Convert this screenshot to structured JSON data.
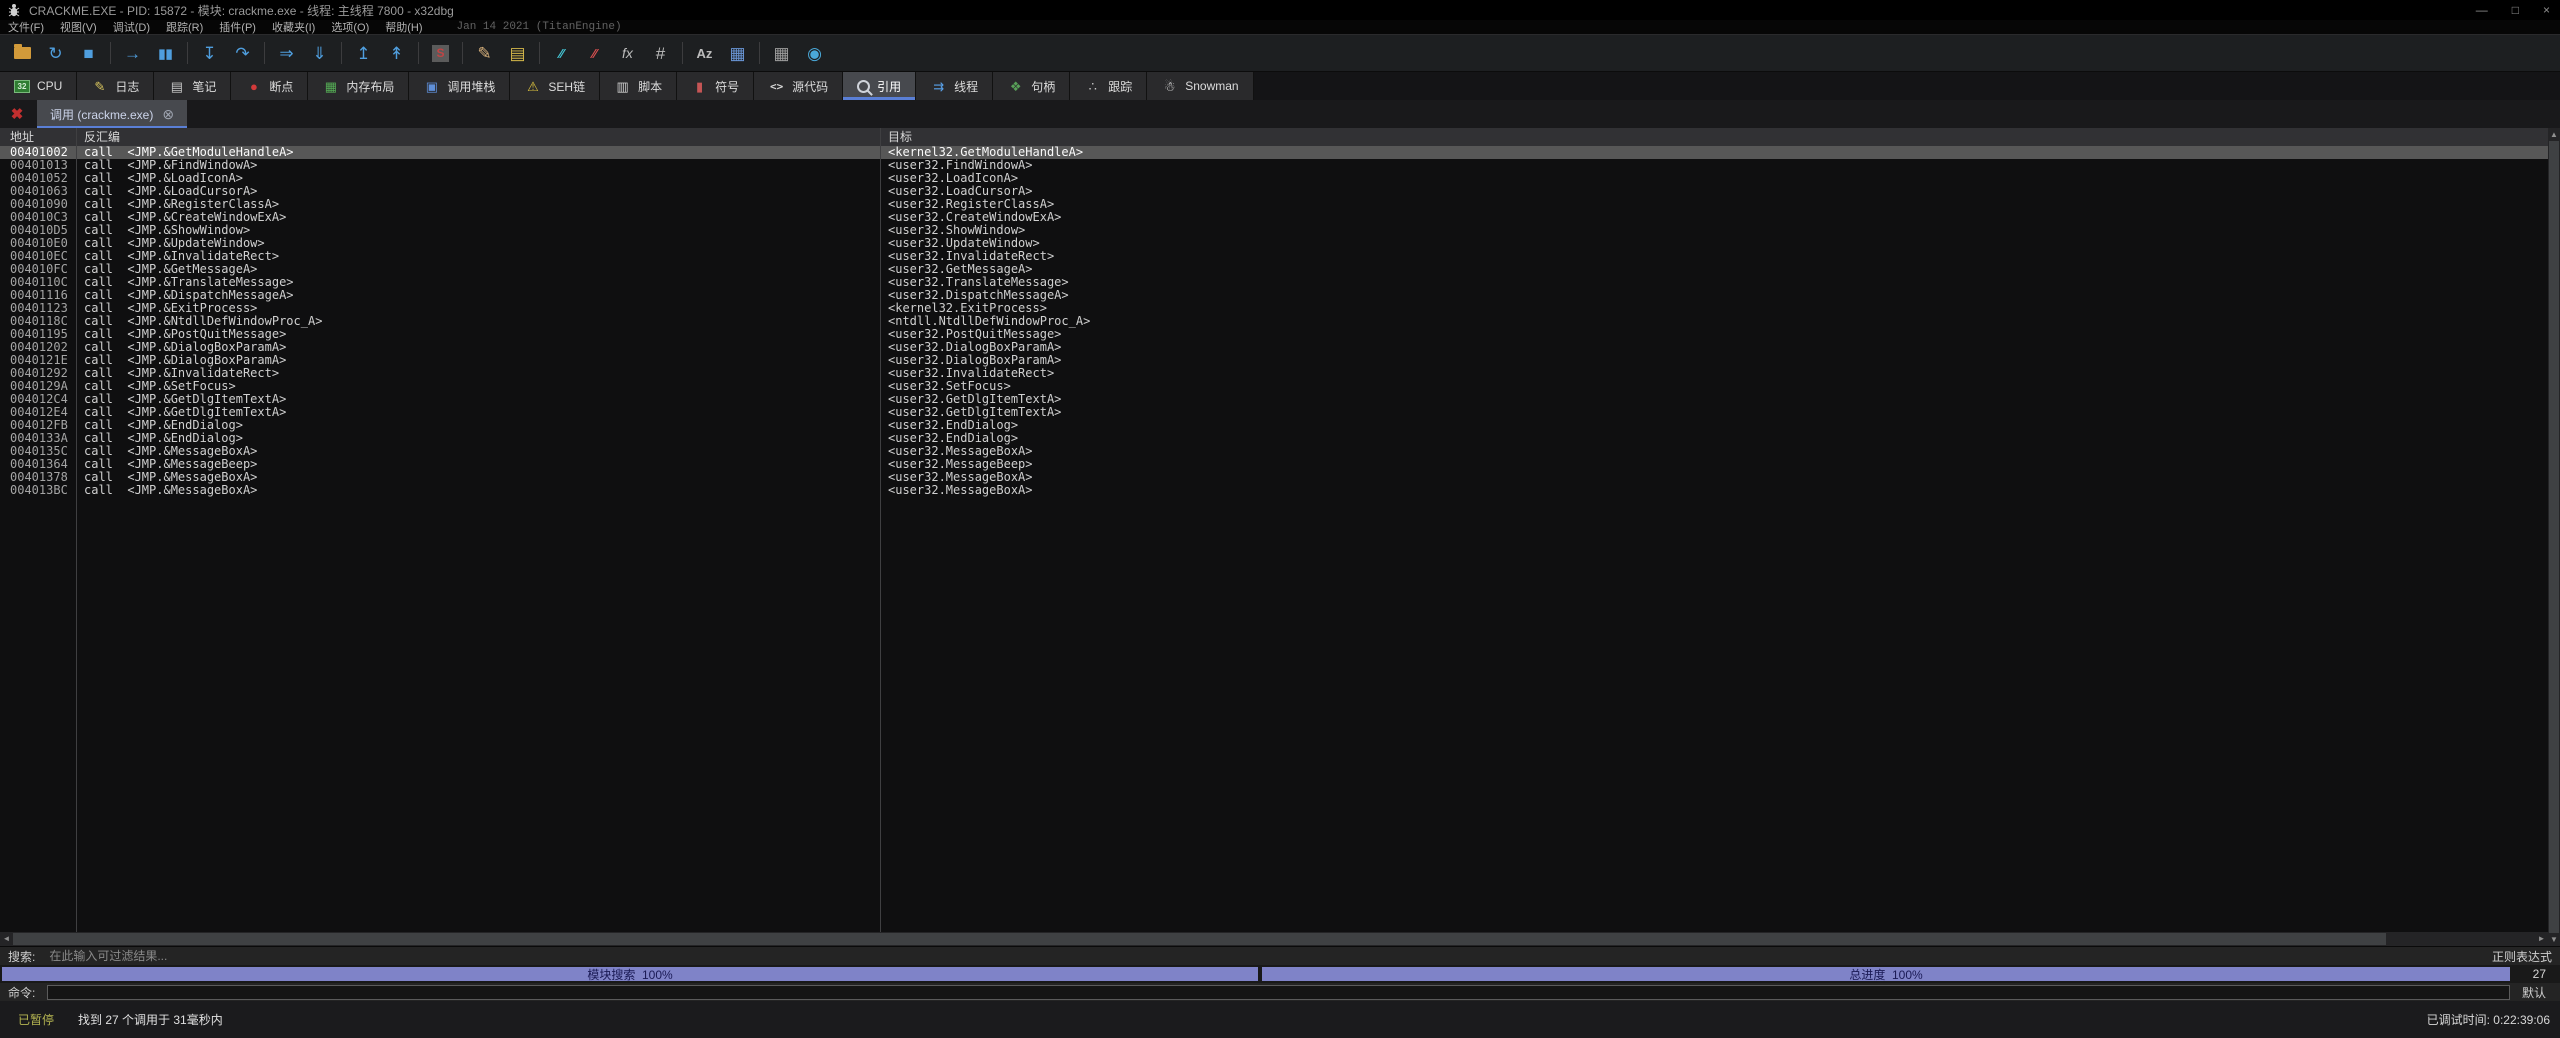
{
  "titlebar": {
    "title": "CRACKME.EXE - PID: 15872 - 模块: crackme.exe - 线程: 主线程 7800 - x32dbg",
    "minimize": "—",
    "maximize": "□",
    "close": "×"
  },
  "menubar": {
    "items": [
      {
        "id": "file",
        "label": "文件(F)"
      },
      {
        "id": "view",
        "label": "视图(V)"
      },
      {
        "id": "debug",
        "label": "调试(D)"
      },
      {
        "id": "trace",
        "label": "跟踪(R)"
      },
      {
        "id": "plugins",
        "label": "插件(P)"
      },
      {
        "id": "favourites",
        "label": "收藏夹(I)"
      },
      {
        "id": "options",
        "label": "选项(O)"
      },
      {
        "id": "help",
        "label": "帮助(H)"
      }
    ],
    "build_info": "Jan 14 2021 (TitanEngine)"
  },
  "toolbar": {
    "items": [
      {
        "type": "icon",
        "name": "open-file-icon",
        "cls": "icon-folder",
        "glyph": "",
        "color": ""
      },
      {
        "type": "icon",
        "name": "restart-icon",
        "glyph": "↻",
        "color": "#4f9ede"
      },
      {
        "type": "icon",
        "name": "stop-icon",
        "glyph": "■",
        "color": "#4f9ede"
      },
      {
        "type": "sep"
      },
      {
        "type": "icon",
        "name": "run-icon",
        "glyph": "→",
        "color": "#4f9ede"
      },
      {
        "type": "icon",
        "name": "pause-icon",
        "glyph": "▮▮",
        "color": "#4f9ede",
        "cls2": "small"
      },
      {
        "type": "sep"
      },
      {
        "type": "icon",
        "name": "step-into-icon",
        "glyph": "↧",
        "color": "#4f9ede"
      },
      {
        "type": "icon",
        "name": "step-over-icon",
        "glyph": "↷",
        "color": "#4f9ede"
      },
      {
        "type": "sep"
      },
      {
        "type": "icon",
        "name": "run-to-user-code-icon",
        "glyph": "⇒",
        "color": "#4f9ede"
      },
      {
        "type": "icon",
        "name": "step-into-trace-icon",
        "glyph": "⇓",
        "color": "#4f9ede"
      },
      {
        "type": "sep"
      },
      {
        "type": "icon",
        "name": "run-until-return-icon",
        "glyph": "↥",
        "color": "#4f9ede"
      },
      {
        "type": "icon",
        "name": "execute-till-return-icon",
        "glyph": "↟",
        "color": "#4f9ede"
      },
      {
        "type": "sep"
      },
      {
        "type": "icon",
        "name": "seh-chain-icon",
        "cls": "icon-sbox",
        "glyph": "S",
        "color": ""
      },
      {
        "type": "sep"
      },
      {
        "type": "icon",
        "name": "patch-icon",
        "glyph": "✎",
        "color": "#d9b27c"
      },
      {
        "type": "icon",
        "name": "comment-icon",
        "glyph": "▤",
        "color": "#d4b74a"
      },
      {
        "type": "sep"
      },
      {
        "type": "icon",
        "name": "trace-coverage-icon",
        "glyph": "∕∕",
        "color": "#45c8d8",
        "cls2": "small"
      },
      {
        "type": "icon",
        "name": "highlight-icon",
        "glyph": "∕∕",
        "color": "#d85050",
        "cls2": "small"
      },
      {
        "type": "icon",
        "name": "functions-icon",
        "glyph": "fx",
        "color": "#bdbdbd",
        "cls2": "ital"
      },
      {
        "type": "icon",
        "name": "hash-icon",
        "glyph": "#",
        "color": "#bdbdbd"
      },
      {
        "type": "sep"
      },
      {
        "type": "icon",
        "name": "font-icon",
        "glyph": "Az",
        "color": "#bdbdbd",
        "cls2": "small"
      },
      {
        "type": "icon",
        "name": "calculator-icon",
        "glyph": "▦",
        "color": "#6a96d6"
      },
      {
        "type": "sep"
      },
      {
        "type": "icon",
        "name": "report-icon",
        "glyph": "▦",
        "color": "#9d9d9d"
      },
      {
        "type": "icon",
        "name": "internet-icon",
        "glyph": "◉",
        "color": "#4aa8d8"
      }
    ]
  },
  "tabbar": {
    "tabs": [
      {
        "id": "cpu",
        "label": "CPU",
        "icon": "cpu-icon",
        "icon_type": "chip",
        "glyph": "32",
        "active": false
      },
      {
        "id": "log",
        "label": "日志",
        "icon": "log-icon",
        "glyph": "✎",
        "color": "#d8c55e",
        "active": false
      },
      {
        "id": "notes",
        "label": "笔记",
        "icon": "notes-icon",
        "glyph": "▤",
        "color": "#c8c8c8",
        "active": false
      },
      {
        "id": "breakpoints",
        "label": "断点",
        "icon": "breakpoint-icon",
        "glyph": "●",
        "color": "#d33a3a",
        "active": false
      },
      {
        "id": "memory-map",
        "label": "内存布局",
        "icon": "memory-map-icon",
        "glyph": "▦",
        "color": "#55ad55",
        "active": false
      },
      {
        "id": "call-stack",
        "label": "调用堆栈",
        "icon": "call-stack-icon",
        "glyph": "▣",
        "color": "#5f8fd8",
        "active": false
      },
      {
        "id": "seh",
        "label": "SEH链",
        "icon": "seh-chain-icon",
        "glyph": "⚠",
        "color": "#dcc23e",
        "active": false
      },
      {
        "id": "script",
        "label": "脚本",
        "icon": "script-icon",
        "glyph": "▥",
        "color": "#cfcfcf",
        "active": false
      },
      {
        "id": "symbols",
        "label": "符号",
        "icon": "symbols-icon",
        "glyph": "▮",
        "color": "#c55555",
        "active": false
      },
      {
        "id": "source",
        "label": "源代码",
        "icon": "source-icon",
        "icon_type": "mono",
        "glyph": "<>",
        "color": "#d8d8d8",
        "active": false
      },
      {
        "id": "references",
        "label": "引用",
        "icon": "references-icon",
        "icon_type": "mag",
        "glyph": "",
        "active": true
      },
      {
        "id": "threads",
        "label": "线程",
        "icon": "threads-icon",
        "glyph": "⇉",
        "color": "#58a0e8",
        "active": false
      },
      {
        "id": "handles",
        "label": "句柄",
        "icon": "handles-icon",
        "glyph": "❖",
        "color": "#58a058",
        "active": false
      },
      {
        "id": "trace",
        "label": "跟踪",
        "icon": "trace-icon",
        "glyph": "∴",
        "color": "#c8c8c8",
        "active": false
      },
      {
        "id": "snowman",
        "label": "Snowman",
        "icon": "snowman-icon",
        "glyph": "☃",
        "color": "#ededed",
        "active": false
      }
    ]
  },
  "subtabbar": {
    "close_glyph": "✖",
    "tab": {
      "label": "调用 (crackme.exe)",
      "close_glyph": "⊗"
    }
  },
  "table": {
    "columns": [
      {
        "label": "地址"
      },
      {
        "label": "反汇编"
      },
      {
        "label": "目标"
      }
    ],
    "selected_index": 0,
    "rows": [
      [
        "00401002",
        "call  <JMP.&GetModuleHandleA>",
        "<kernel32.GetModuleHandleA>"
      ],
      [
        "00401013",
        "call  <JMP.&FindWindowA>",
        "<user32.FindWindowA>"
      ],
      [
        "00401052",
        "call  <JMP.&LoadIconA>",
        "<user32.LoadIconA>"
      ],
      [
        "00401063",
        "call  <JMP.&LoadCursorA>",
        "<user32.LoadCursorA>"
      ],
      [
        "00401090",
        "call  <JMP.&RegisterClassA>",
        "<user32.RegisterClassA>"
      ],
      [
        "004010C3",
        "call  <JMP.&CreateWindowExA>",
        "<user32.CreateWindowExA>"
      ],
      [
        "004010D5",
        "call  <JMP.&ShowWindow>",
        "<user32.ShowWindow>"
      ],
      [
        "004010E0",
        "call  <JMP.&UpdateWindow>",
        "<user32.UpdateWindow>"
      ],
      [
        "004010EC",
        "call  <JMP.&InvalidateRect>",
        "<user32.InvalidateRect>"
      ],
      [
        "004010FC",
        "call  <JMP.&GetMessageA>",
        "<user32.GetMessageA>"
      ],
      [
        "0040110C",
        "call  <JMP.&TranslateMessage>",
        "<user32.TranslateMessage>"
      ],
      [
        "00401116",
        "call  <JMP.&DispatchMessageA>",
        "<user32.DispatchMessageA>"
      ],
      [
        "00401123",
        "call  <JMP.&ExitProcess>",
        "<kernel32.ExitProcess>"
      ],
      [
        "0040118C",
        "call  <JMP.&NtdllDefWindowProc_A>",
        "<ntdll.NtdllDefWindowProc_A>"
      ],
      [
        "00401195",
        "call  <JMP.&PostQuitMessage>",
        "<user32.PostQuitMessage>"
      ],
      [
        "00401202",
        "call  <JMP.&DialogBoxParamA>",
        "<user32.DialogBoxParamA>"
      ],
      [
        "0040121E",
        "call  <JMP.&DialogBoxParamA>",
        "<user32.DialogBoxParamA>"
      ],
      [
        "00401292",
        "call  <JMP.&InvalidateRect>",
        "<user32.InvalidateRect>"
      ],
      [
        "0040129A",
        "call  <JMP.&SetFocus>",
        "<user32.SetFocus>"
      ],
      [
        "004012C4",
        "call  <JMP.&GetDlgItemTextA>",
        "<user32.GetDlgItemTextA>"
      ],
      [
        "004012E4",
        "call  <JMP.&GetDlgItemTextA>",
        "<user32.GetDlgItemTextA>"
      ],
      [
        "004012FB",
        "call  <JMP.&EndDialog>",
        "<user32.EndDialog>"
      ],
      [
        "0040133A",
        "call  <JMP.&EndDialog>",
        "<user32.EndDialog>"
      ],
      [
        "0040135C",
        "call  <JMP.&MessageBoxA>",
        "<user32.MessageBoxA>"
      ],
      [
        "00401364",
        "call  <JMP.&MessageBeep>",
        "<user32.MessageBeep>"
      ],
      [
        "00401378",
        "call  <JMP.&MessageBoxA>",
        "<user32.MessageBoxA>"
      ],
      [
        "004013BC",
        "call  <JMP.&MessageBoxA>",
        "<user32.MessageBoxA>"
      ]
    ]
  },
  "scrollbars": {
    "up": "▲",
    "down": "▼",
    "left": "◄",
    "right": "►"
  },
  "search": {
    "label": "搜索:",
    "placeholder": "在此输入可过滤结果...",
    "regex_label": "正则表达式"
  },
  "progress": {
    "bar1": {
      "label": "模块搜索",
      "percent": 100,
      "text": "模块搜索  100%"
    },
    "bar2": {
      "label": "总进度",
      "percent": 100,
      "text": "总进度  100%"
    },
    "result_count": "27",
    "bar_color": "#7f83c8"
  },
  "command": {
    "label": "命令:",
    "value": "",
    "profile": "默认"
  },
  "statusbar": {
    "state": "已暂停",
    "message": "找到 27 个调用于 31毫秒内",
    "debug_time": "已调试时间: 0:22:39:06"
  },
  "colors": {
    "accent_blue": "#5a7fd6",
    "selected_row_bg": "#575757",
    "progress_bar": "#7f83c8",
    "paused_state": "#b6b652",
    "breakpoint_red": "#d33a3a"
  }
}
